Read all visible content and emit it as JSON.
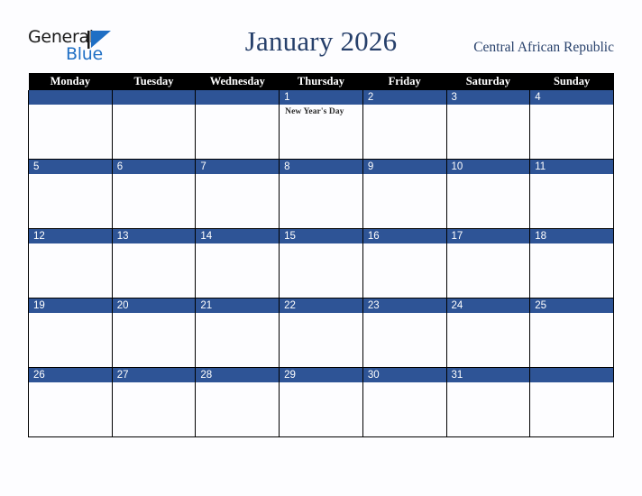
{
  "brand": {
    "name_part1": "General",
    "name_part2": "Blue",
    "mark": "triangle-icon",
    "color_dark": "#1a1a1a",
    "color_blue": "#1f6fc4"
  },
  "header": {
    "title": "January 2026",
    "country": "Central African Republic",
    "title_color": "#27406b"
  },
  "theme": {
    "header_bg": "#000000",
    "daybar_bg": "#2e5496",
    "cell_bg": "#fdfdff",
    "page_bg": "#fdfdff",
    "border": "#000000"
  },
  "calendar": {
    "weekday_headers": [
      "Monday",
      "Tuesday",
      "Wednesday",
      "Thursday",
      "Friday",
      "Saturday",
      "Sunday"
    ],
    "weeks": [
      [
        {
          "date": "",
          "events": []
        },
        {
          "date": "",
          "events": []
        },
        {
          "date": "",
          "events": []
        },
        {
          "date": "1",
          "events": [
            "New Year's Day"
          ]
        },
        {
          "date": "2",
          "events": []
        },
        {
          "date": "3",
          "events": []
        },
        {
          "date": "4",
          "events": []
        }
      ],
      [
        {
          "date": "5",
          "events": []
        },
        {
          "date": "6",
          "events": []
        },
        {
          "date": "7",
          "events": []
        },
        {
          "date": "8",
          "events": []
        },
        {
          "date": "9",
          "events": []
        },
        {
          "date": "10",
          "events": []
        },
        {
          "date": "11",
          "events": []
        }
      ],
      [
        {
          "date": "12",
          "events": []
        },
        {
          "date": "13",
          "events": []
        },
        {
          "date": "14",
          "events": []
        },
        {
          "date": "15",
          "events": []
        },
        {
          "date": "16",
          "events": []
        },
        {
          "date": "17",
          "events": []
        },
        {
          "date": "18",
          "events": []
        }
      ],
      [
        {
          "date": "19",
          "events": []
        },
        {
          "date": "20",
          "events": []
        },
        {
          "date": "21",
          "events": []
        },
        {
          "date": "22",
          "events": []
        },
        {
          "date": "23",
          "events": []
        },
        {
          "date": "24",
          "events": []
        },
        {
          "date": "25",
          "events": []
        }
      ],
      [
        {
          "date": "26",
          "events": []
        },
        {
          "date": "27",
          "events": []
        },
        {
          "date": "28",
          "events": []
        },
        {
          "date": "29",
          "events": []
        },
        {
          "date": "30",
          "events": []
        },
        {
          "date": "31",
          "events": []
        },
        {
          "date": "",
          "events": []
        }
      ]
    ]
  }
}
